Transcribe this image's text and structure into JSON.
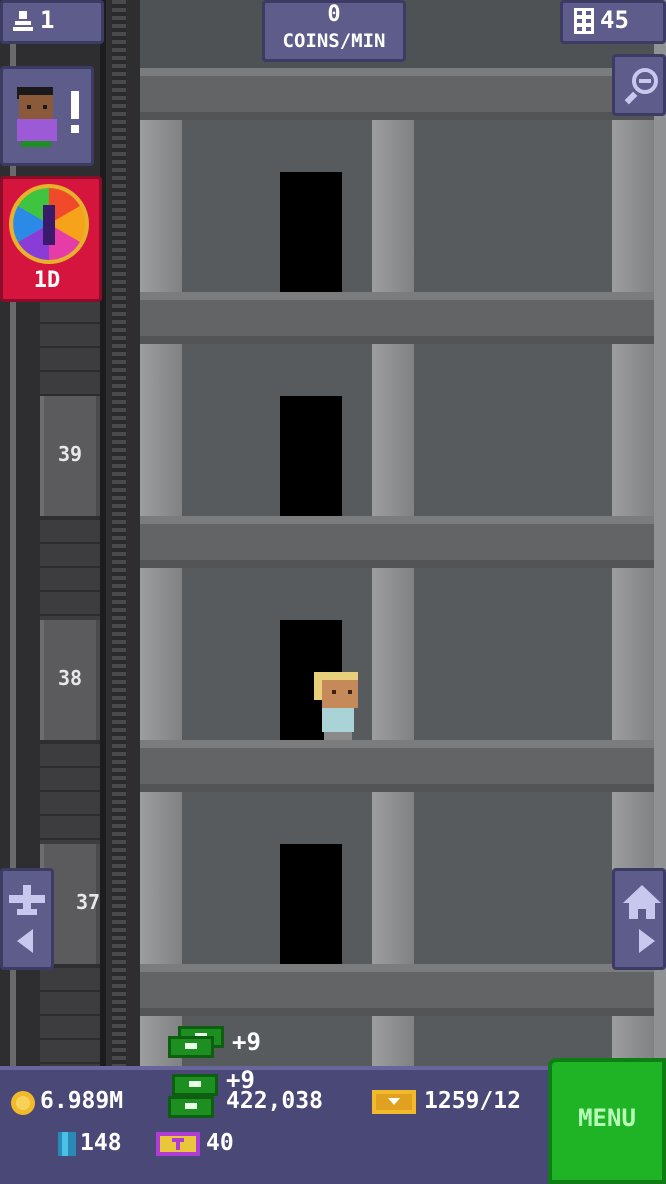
{
  "hud": {
    "population": "1",
    "coins_per_min_value": "0",
    "coins_per_min_label": "COINS/MIN",
    "floor_count": "45",
    "lucky_wheel_timer": "1D"
  },
  "shaft_floor_labels": [
    "39",
    "38",
    "37"
  ],
  "income_popups": [
    "+9",
    "+9"
  ],
  "stats": {
    "coins": "6.989M",
    "bux_cost": "422,038",
    "gold_tickets": "1259/12",
    "blue_items": "148",
    "tower_bux": "40"
  },
  "menu_label": "MENU",
  "colors": {
    "hud_purple": "#5d5c8a",
    "wheel_red": "#d5153e",
    "menu_green": "#1fb425",
    "bottom_bar": "#4a4877"
  },
  "icons": [
    "person-icon",
    "floors-icon",
    "zoom-out-icon",
    "visitor-icon",
    "lucky-wheel-icon",
    "plane-icon",
    "house-icon",
    "coin-icon",
    "gold-ticket-icon",
    "blue-item-icon",
    "bux-icon",
    "money-icon"
  ]
}
